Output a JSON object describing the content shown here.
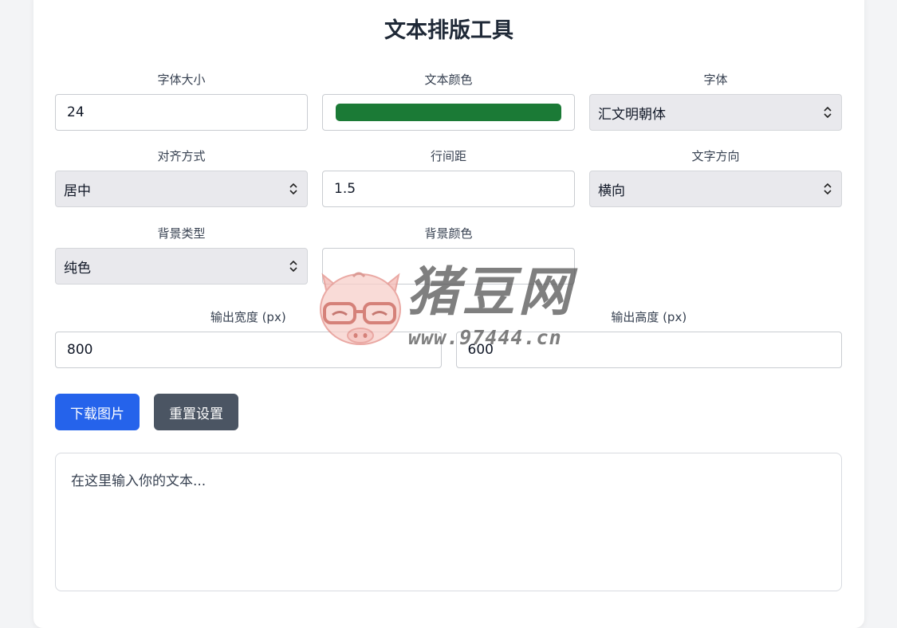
{
  "page": {
    "title": "文本排版工具"
  },
  "controls": {
    "font_size": {
      "label": "字体大小",
      "value": "24"
    },
    "text_color": {
      "label": "文本颜色",
      "color": "#1b7a36"
    },
    "font_family": {
      "label": "字体",
      "value": "汇文明朝体"
    },
    "alignment": {
      "label": "对齐方式",
      "value": "居中"
    },
    "line_height": {
      "label": "行间距",
      "value": "1.5"
    },
    "text_direction": {
      "label": "文字方向",
      "value": "横向"
    },
    "background_type": {
      "label": "背景类型",
      "value": "纯色"
    },
    "background_color": {
      "label": "背景颜色",
      "color": "#ffffff"
    },
    "output_width": {
      "label": "输出宽度 (px)",
      "value": "800"
    },
    "output_height": {
      "label": "输出高度 (px)",
      "value": "600"
    }
  },
  "actions": {
    "download_label": "下载图片",
    "reset_label": "重置设置"
  },
  "editor": {
    "text": "在这里输入你的文本..."
  },
  "watermark": {
    "brand": "猪豆网",
    "url": "www.97444.cn"
  },
  "colors": {
    "primary": "#2563eb",
    "secondary": "#4b5563",
    "text_color_swatch": "#1b7a36"
  }
}
